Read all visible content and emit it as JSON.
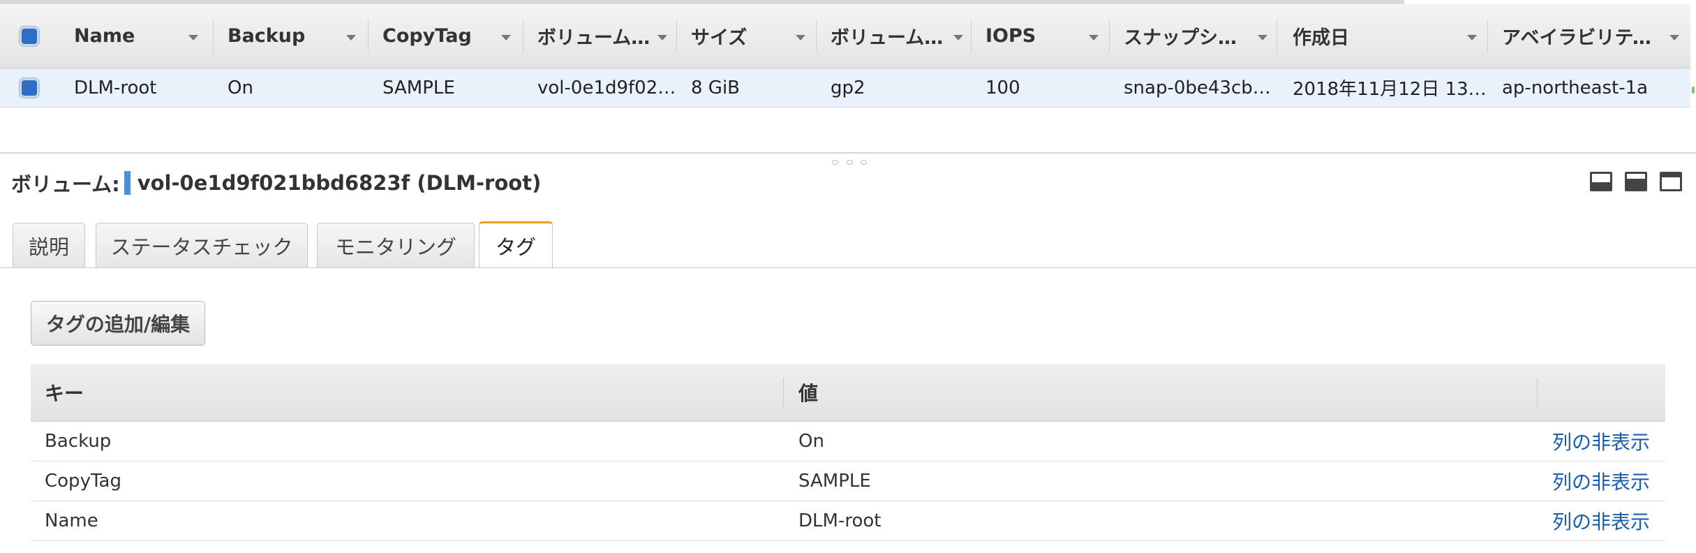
{
  "volumes_grid": {
    "columns": [
      {
        "label": "Name"
      },
      {
        "label": "Backup"
      },
      {
        "label": "CopyTag"
      },
      {
        "label": "ボリューム ID"
      },
      {
        "label": "サイズ"
      },
      {
        "label": "ボリュームタイプ"
      },
      {
        "label": "IOPS"
      },
      {
        "label": "スナップショット"
      },
      {
        "label": "作成日"
      },
      {
        "label": "アベイラビリティーゾーン"
      }
    ],
    "rows": [
      {
        "selected": true,
        "cells": [
          "DLM-root",
          "On",
          "SAMPLE",
          "vol-0e1d9f02…",
          "8 GiB",
          "gp2",
          "100",
          "snap-0be43cb…",
          "2018年11月12日 13…",
          "ap-northeast-1a"
        ]
      }
    ]
  },
  "detail": {
    "title_prefix": "ボリューム:",
    "volume_label": "vol-0e1d9f021bbd6823f (DLM-root)",
    "layout_icons": [
      "panel-bottom-icon",
      "panel-half-icon",
      "panel-max-icon"
    ],
    "tabs": [
      {
        "label": "説明",
        "active": false
      },
      {
        "label": "ステータスチェック",
        "active": false
      },
      {
        "label": "モニタリング",
        "active": false
      },
      {
        "label": "タグ",
        "active": true
      }
    ],
    "add_edit_button": "タグの追加/編集",
    "tags_table": {
      "headers": {
        "key": "キー",
        "value": "値"
      },
      "rows": [
        {
          "key": "Backup",
          "value": "On",
          "action": "列の非表示"
        },
        {
          "key": "CopyTag",
          "value": "SAMPLE",
          "action": "列の非表示"
        },
        {
          "key": "Name",
          "value": "DLM-root",
          "action": "列の非表示"
        }
      ]
    }
  },
  "colors": {
    "accent_blue": "#4d8fd4",
    "tab_active_border": "#f09a2a",
    "link": "#1a5ea8",
    "checkbox_blue": "#2d6ec9",
    "selected_row": "#e9f2fb"
  }
}
